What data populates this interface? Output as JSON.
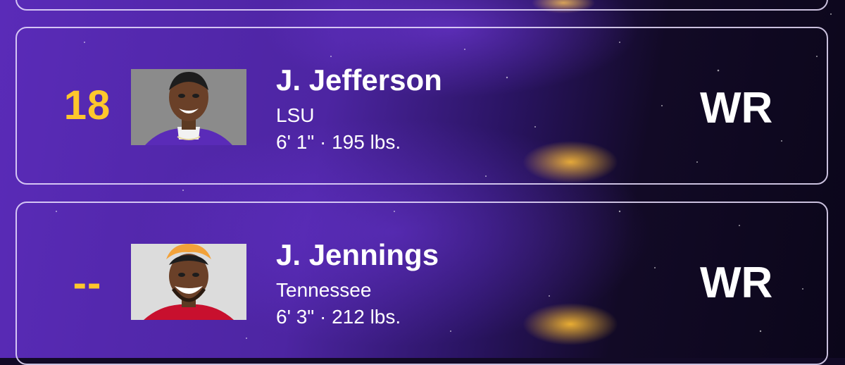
{
  "players": [
    {
      "rank": "18",
      "name": "J. Jefferson",
      "school": "LSU",
      "measurements": "6' 1\" · 195 lbs.",
      "position": "WR"
    },
    {
      "rank": "--",
      "name": "J. Jennings",
      "school": "Tennessee",
      "measurements": "6' 3\" · 212 lbs.",
      "position": "WR"
    }
  ],
  "colors": {
    "accent_gold": "#ffc72c",
    "purple": "#4d25a2",
    "text": "#ffffff"
  }
}
